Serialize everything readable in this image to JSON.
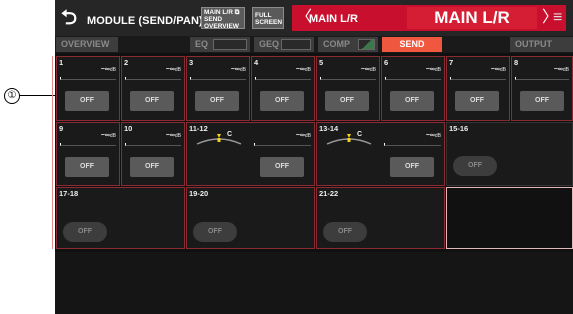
{
  "callout": {
    "number": "①"
  },
  "header": {
    "back_glyph": "⮌",
    "title": "MODULE (SEND/PAN)",
    "overview_chip": "MAIN L/R ⧉\nSEND\nOVERVIEW",
    "fullscreen_chip": "FULL\nSCREEN",
    "prev_glyph": "〈",
    "prev_label": "MAIN L/R",
    "current": "MAIN L/R",
    "next_glyph": "〉",
    "menu_glyph": "≡"
  },
  "tabs": [
    {
      "label": "OVERVIEW",
      "active": false
    },
    {
      "label": "EQ",
      "active": false
    },
    {
      "label": "GEQ",
      "active": false
    },
    {
      "label": "COMP",
      "active": false
    },
    {
      "label": "SEND",
      "active": true
    },
    {
      "label": "OUTPUT",
      "active": false
    }
  ],
  "channels_row1": [
    {
      "label": "1",
      "level": "−∞",
      "unit": "dB",
      "button": "OFF"
    },
    {
      "label": "2",
      "level": "−∞",
      "unit": "dB",
      "button": "OFF"
    },
    {
      "label": "3",
      "level": "−∞",
      "unit": "dB",
      "button": "OFF"
    },
    {
      "label": "4",
      "level": "−∞",
      "unit": "dB",
      "button": "OFF"
    },
    {
      "label": "5",
      "level": "−∞",
      "unit": "dB",
      "button": "OFF"
    },
    {
      "label": "6",
      "level": "−∞",
      "unit": "dB",
      "button": "OFF"
    },
    {
      "label": "7",
      "level": "−∞",
      "unit": "dB",
      "button": "OFF"
    },
    {
      "label": "8",
      "level": "−∞",
      "unit": "dB",
      "button": "OFF"
    }
  ],
  "channels_row2": [
    {
      "label": "9",
      "level": "−∞",
      "unit": "dB",
      "button": "OFF"
    },
    {
      "label": "10",
      "level": "−∞",
      "unit": "dB",
      "button": "OFF"
    },
    {
      "label": "11-12",
      "pan": "C",
      "level": "−∞",
      "unit": "dB",
      "button": "OFF"
    },
    {
      "label": "13-14",
      "pan": "C",
      "level": "−∞",
      "unit": "dB",
      "button": "OFF"
    },
    {
      "label": "15-16",
      "button": "OFF"
    }
  ],
  "channels_row3": [
    {
      "label": "17-18",
      "button": "OFF"
    },
    {
      "label": "19-20",
      "button": "OFF"
    },
    {
      "label": "21-22",
      "button": "OFF"
    }
  ]
}
